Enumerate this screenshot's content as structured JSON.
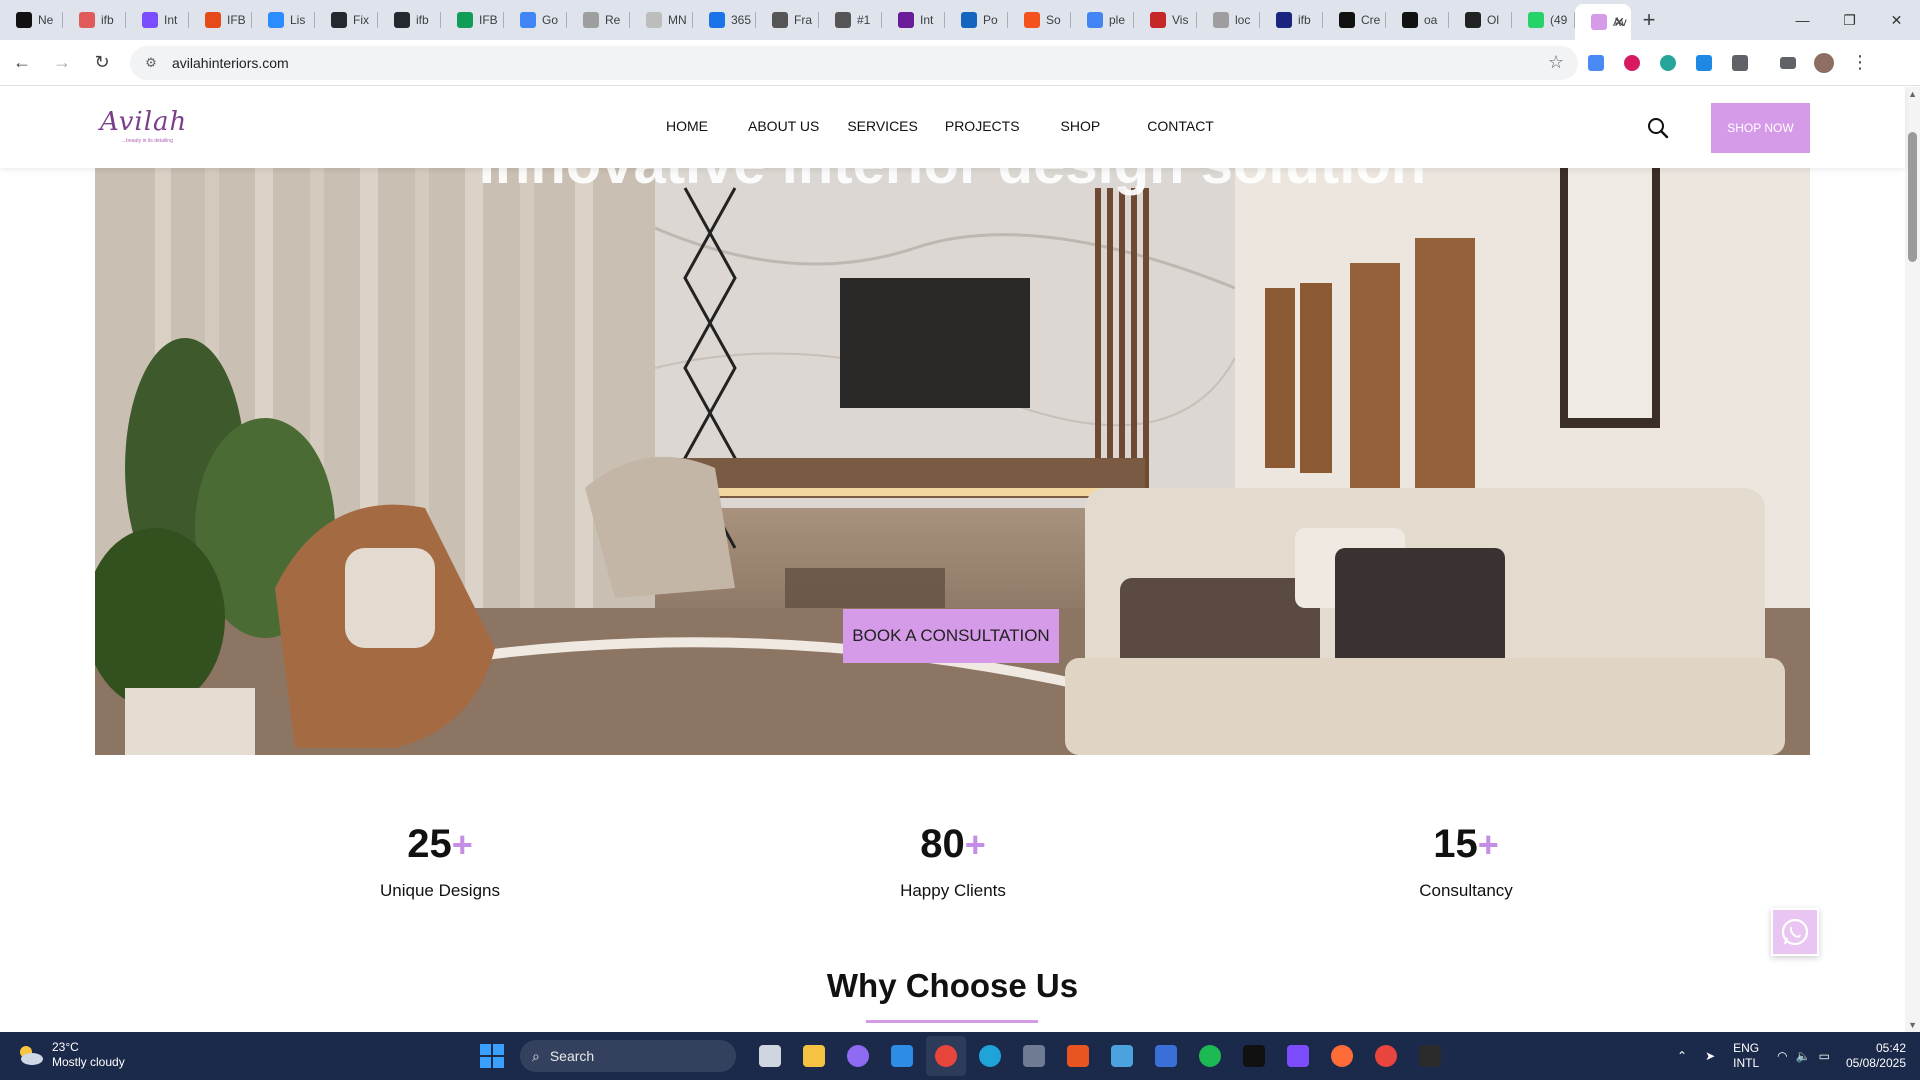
{
  "browser": {
    "tabs": [
      {
        "label": "Ne",
        "color": "#111111"
      },
      {
        "label": "ifb",
        "color": "#e05a5a"
      },
      {
        "label": "Int",
        "color": "#7c4dff"
      },
      {
        "label": "IFB",
        "color": "#e64a19"
      },
      {
        "label": "Lis",
        "color": "#2d8cff"
      },
      {
        "label": "Fix",
        "color": "#24292f"
      },
      {
        "label": "ifb",
        "color": "#24292f"
      },
      {
        "label": "IFB",
        "color": "#0f9d58"
      },
      {
        "label": "Go",
        "color": "#4285f4"
      },
      {
        "label": "Re",
        "color": "#9e9e9e"
      },
      {
        "label": "MN",
        "color": "#bdbdbd"
      },
      {
        "label": "365",
        "color": "#1a73e8"
      },
      {
        "label": "Fra",
        "color": "#555555"
      },
      {
        "label": "#1",
        "color": "#555555"
      },
      {
        "label": "Int",
        "color": "#6a1b9a"
      },
      {
        "label": "Po",
        "color": "#1565c0"
      },
      {
        "label": "So",
        "color": "#f4511e"
      },
      {
        "label": "ple",
        "color": "#4285f4"
      },
      {
        "label": "Vis",
        "color": "#c62828"
      },
      {
        "label": "loc",
        "color": "#9e9e9e"
      },
      {
        "label": "ifb",
        "color": "#1a237e"
      },
      {
        "label": "Cre",
        "color": "#111111"
      },
      {
        "label": "oa",
        "color": "#111111"
      },
      {
        "label": "Ol",
        "color": "#222222"
      },
      {
        "label": "(49",
        "color": "#25d366"
      },
      {
        "label": "Av",
        "color": "#d69be8"
      }
    ],
    "active_tab_close": "✕",
    "new_tab": "+",
    "address": "avilahinteriors.com"
  },
  "site": {
    "logo": "Avilah",
    "logo_tagline": "...beauty in its detailing",
    "nav": [
      "HOME",
      "ABOUT US",
      "SERVICES",
      "PROJECTS",
      "SHOP",
      "CONTACT"
    ],
    "shop_button": "SHOP NOW",
    "hero_title": "Innovative interior design solution",
    "consult_button": "BOOK A CONSULTATION",
    "stats": [
      {
        "number": "25",
        "plus": "+",
        "label": "Unique Designs"
      },
      {
        "number": "80",
        "plus": "+",
        "label": "Happy Clients"
      },
      {
        "number": "15",
        "plus": "+",
        "label": "Consultancy"
      }
    ],
    "section_title": "Why Choose Us",
    "accent_color": "#d69be8"
  },
  "taskbar": {
    "weather_temp": "23°C",
    "weather_desc": "Mostly cloudy",
    "search_placeholder": "Search",
    "lang_top": "ENG",
    "lang_bottom": "INTL",
    "time": "05:42",
    "date": "05/08/2025"
  }
}
